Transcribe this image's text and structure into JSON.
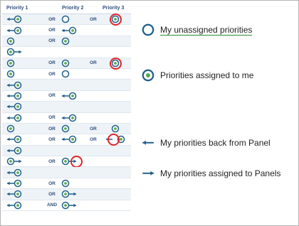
{
  "colors": {
    "symbol": "#1f5f8a",
    "dot": "#5aa84f",
    "highlight": "#e0262b",
    "header_text": "#2f4f7f"
  },
  "header": {
    "col1": "Priority 1",
    "col2": "Priority 2",
    "col3": "Priority 3"
  },
  "rows": [
    {
      "c1": "back-target",
      "op1": "OR",
      "c2": "unassigned",
      "op2": "OR",
      "c3": "assigned",
      "hl": "c3"
    },
    {
      "c1": "back-target",
      "op1": "OR",
      "c2": "back-target",
      "op2": "",
      "c3": "",
      "hl": ""
    },
    {
      "c1": "assigned",
      "op1": "OR",
      "c2": "assigned",
      "op2": "",
      "c3": "",
      "hl": ""
    },
    {
      "c1": "target-forward",
      "op1": "",
      "c2": "",
      "op2": "",
      "c3": "",
      "hl": ""
    },
    {
      "c1": "assigned",
      "op1": "OR",
      "c2": "assigned",
      "op2": "OR",
      "c3": "assigned",
      "hl": "c3"
    },
    {
      "c1": "assigned",
      "op1": "OR",
      "c2": "unassigned",
      "op2": "",
      "c3": "",
      "hl": ""
    },
    {
      "c1": "back-target",
      "op1": "",
      "c2": "",
      "op2": "",
      "c3": "",
      "hl": ""
    },
    {
      "c1": "back-target",
      "op1": "OR",
      "c2": "back-target",
      "op2": "",
      "c3": "",
      "hl": ""
    },
    {
      "c1": "back-target",
      "op1": "",
      "c2": "",
      "op2": "",
      "c3": "",
      "hl": ""
    },
    {
      "c1": "back-target",
      "op1": "OR",
      "c2": "back-target",
      "op2": "",
      "c3": "",
      "hl": ""
    },
    {
      "c1": "assigned",
      "op1": "OR",
      "c2": "assigned",
      "op2": "OR",
      "c3": "assigned",
      "hl": ""
    },
    {
      "c1": "back-target",
      "op1": "OR",
      "c2": "back-target",
      "op2": "OR",
      "c3": "back-target-pair",
      "hl": "c3"
    },
    {
      "c1": "back-target",
      "op1": "",
      "c2": "",
      "op2": "",
      "c3": "",
      "hl": ""
    },
    {
      "c1": "target-forward",
      "op1": "OR",
      "c2": "target-forward",
      "op2": "",
      "c3": "",
      "hl": "c2"
    },
    {
      "c1": "back-target",
      "op1": "",
      "c2": "",
      "op2": "",
      "c3": "",
      "hl": ""
    },
    {
      "c1": "back-target",
      "op1": "OR",
      "c2": "assigned",
      "op2": "",
      "c3": "",
      "hl": ""
    },
    {
      "c1": "back-target",
      "op1": "OR",
      "c2": "target-forward",
      "op2": "",
      "c3": "",
      "hl": ""
    },
    {
      "c1": "back-target",
      "op1": "AND",
      "c2": "target-forward",
      "op2": "",
      "c3": "",
      "hl": ""
    }
  ],
  "legend": {
    "unassigned": "My unassigned priorities",
    "assigned": "Priorities assigned to me",
    "back": "My priorities back from Panel",
    "forward": "My priorities assigned to Panels"
  }
}
